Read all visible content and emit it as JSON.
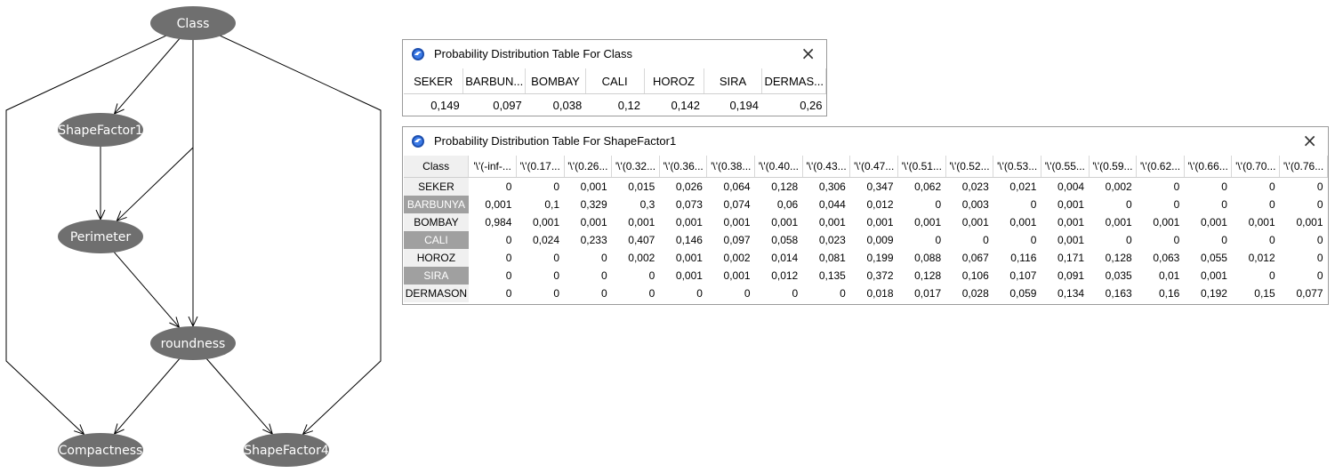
{
  "graph": {
    "nodes": [
      {
        "id": "class",
        "label": "Class"
      },
      {
        "id": "shapefactor1",
        "label": "ShapeFactor1"
      },
      {
        "id": "perimeter",
        "label": "Perimeter"
      },
      {
        "id": "roundness",
        "label": "roundness"
      },
      {
        "id": "compactness",
        "label": "Compactness"
      },
      {
        "id": "shapefactor4",
        "label": "ShapeFactor4"
      }
    ],
    "edges": [
      [
        "class",
        "shapefactor1"
      ],
      [
        "class",
        "perimeter"
      ],
      [
        "class",
        "roundness"
      ],
      [
        "class",
        "compactness"
      ],
      [
        "class",
        "shapefactor4"
      ],
      [
        "shapefactor1",
        "perimeter"
      ],
      [
        "perimeter",
        "roundness"
      ],
      [
        "roundness",
        "compactness"
      ],
      [
        "roundness",
        "shapefactor4"
      ]
    ],
    "colors": {
      "node": "#6f6f6f",
      "edge": "#000000"
    }
  },
  "class_window": {
    "title": "Probability Distribution Table For Class",
    "close_label": "×",
    "columns": [
      "SEKER",
      "BARBUN...",
      "BOMBAY",
      "CALI",
      "HOROZ",
      "SIRA",
      "DERMAS..."
    ],
    "values": [
      "0,149",
      "0,097",
      "0,038",
      "0,12",
      "0,142",
      "0,194",
      "0,26"
    ]
  },
  "sf1_window": {
    "title": "Probability Distribution Table For ShapeFactor1",
    "close_label": "×",
    "corner_header": "Class",
    "columns": [
      "'\\'(-inf-...",
      "'\\'(0.17...",
      "'\\'(0.26...",
      "'\\'(0.32...",
      "'\\'(0.36...",
      "'\\'(0.38...",
      "'\\'(0.40...",
      "'\\'(0.43...",
      "'\\'(0.47...",
      "'\\'(0.51...",
      "'\\'(0.52...",
      "'\\'(0.53...",
      "'\\'(0.55...",
      "'\\'(0.59...",
      "'\\'(0.62...",
      "'\\'(0.66...",
      "'\\'(0.70...",
      "'\\'(0.76..."
    ],
    "rows": [
      {
        "label": "SEKER",
        "selected": false,
        "values": [
          "0",
          "0",
          "0,001",
          "0,015",
          "0,026",
          "0,064",
          "0,128",
          "0,306",
          "0,347",
          "0,062",
          "0,023",
          "0,021",
          "0,004",
          "0,002",
          "0",
          "0",
          "0",
          "0"
        ]
      },
      {
        "label": "BARBUNYA",
        "selected": true,
        "values": [
          "0,001",
          "0,1",
          "0,329",
          "0,3",
          "0,073",
          "0,074",
          "0,06",
          "0,044",
          "0,012",
          "0",
          "0,003",
          "0",
          "0,001",
          "0",
          "0",
          "0",
          "0",
          "0"
        ]
      },
      {
        "label": "BOMBAY",
        "selected": false,
        "values": [
          "0,984",
          "0,001",
          "0,001",
          "0,001",
          "0,001",
          "0,001",
          "0,001",
          "0,001",
          "0,001",
          "0,001",
          "0,001",
          "0,001",
          "0,001",
          "0,001",
          "0,001",
          "0,001",
          "0,001",
          "0,001"
        ]
      },
      {
        "label": "CALI",
        "selected": true,
        "values": [
          "0",
          "0,024",
          "0,233",
          "0,407",
          "0,146",
          "0,097",
          "0,058",
          "0,023",
          "0,009",
          "0",
          "0",
          "0",
          "0,001",
          "0",
          "0",
          "0",
          "0",
          "0"
        ]
      },
      {
        "label": "HOROZ",
        "selected": false,
        "values": [
          "0",
          "0",
          "0",
          "0,002",
          "0,001",
          "0,002",
          "0,014",
          "0,081",
          "0,199",
          "0,088",
          "0,067",
          "0,116",
          "0,171",
          "0,128",
          "0,063",
          "0,055",
          "0,012",
          "0"
        ]
      },
      {
        "label": "SIRA",
        "selected": true,
        "values": [
          "0",
          "0",
          "0",
          "0",
          "0,001",
          "0,001",
          "0,012",
          "0,135",
          "0,372",
          "0,128",
          "0,106",
          "0,107",
          "0,091",
          "0,035",
          "0,01",
          "0,001",
          "0",
          "0"
        ]
      },
      {
        "label": "DERMASON",
        "selected": false,
        "values": [
          "0",
          "0",
          "0",
          "0",
          "0",
          "0",
          "0",
          "0",
          "0,018",
          "0,017",
          "0,028",
          "0,059",
          "0,134",
          "0,163",
          "0,16",
          "0,192",
          "0,15",
          "0,077"
        ]
      }
    ]
  }
}
